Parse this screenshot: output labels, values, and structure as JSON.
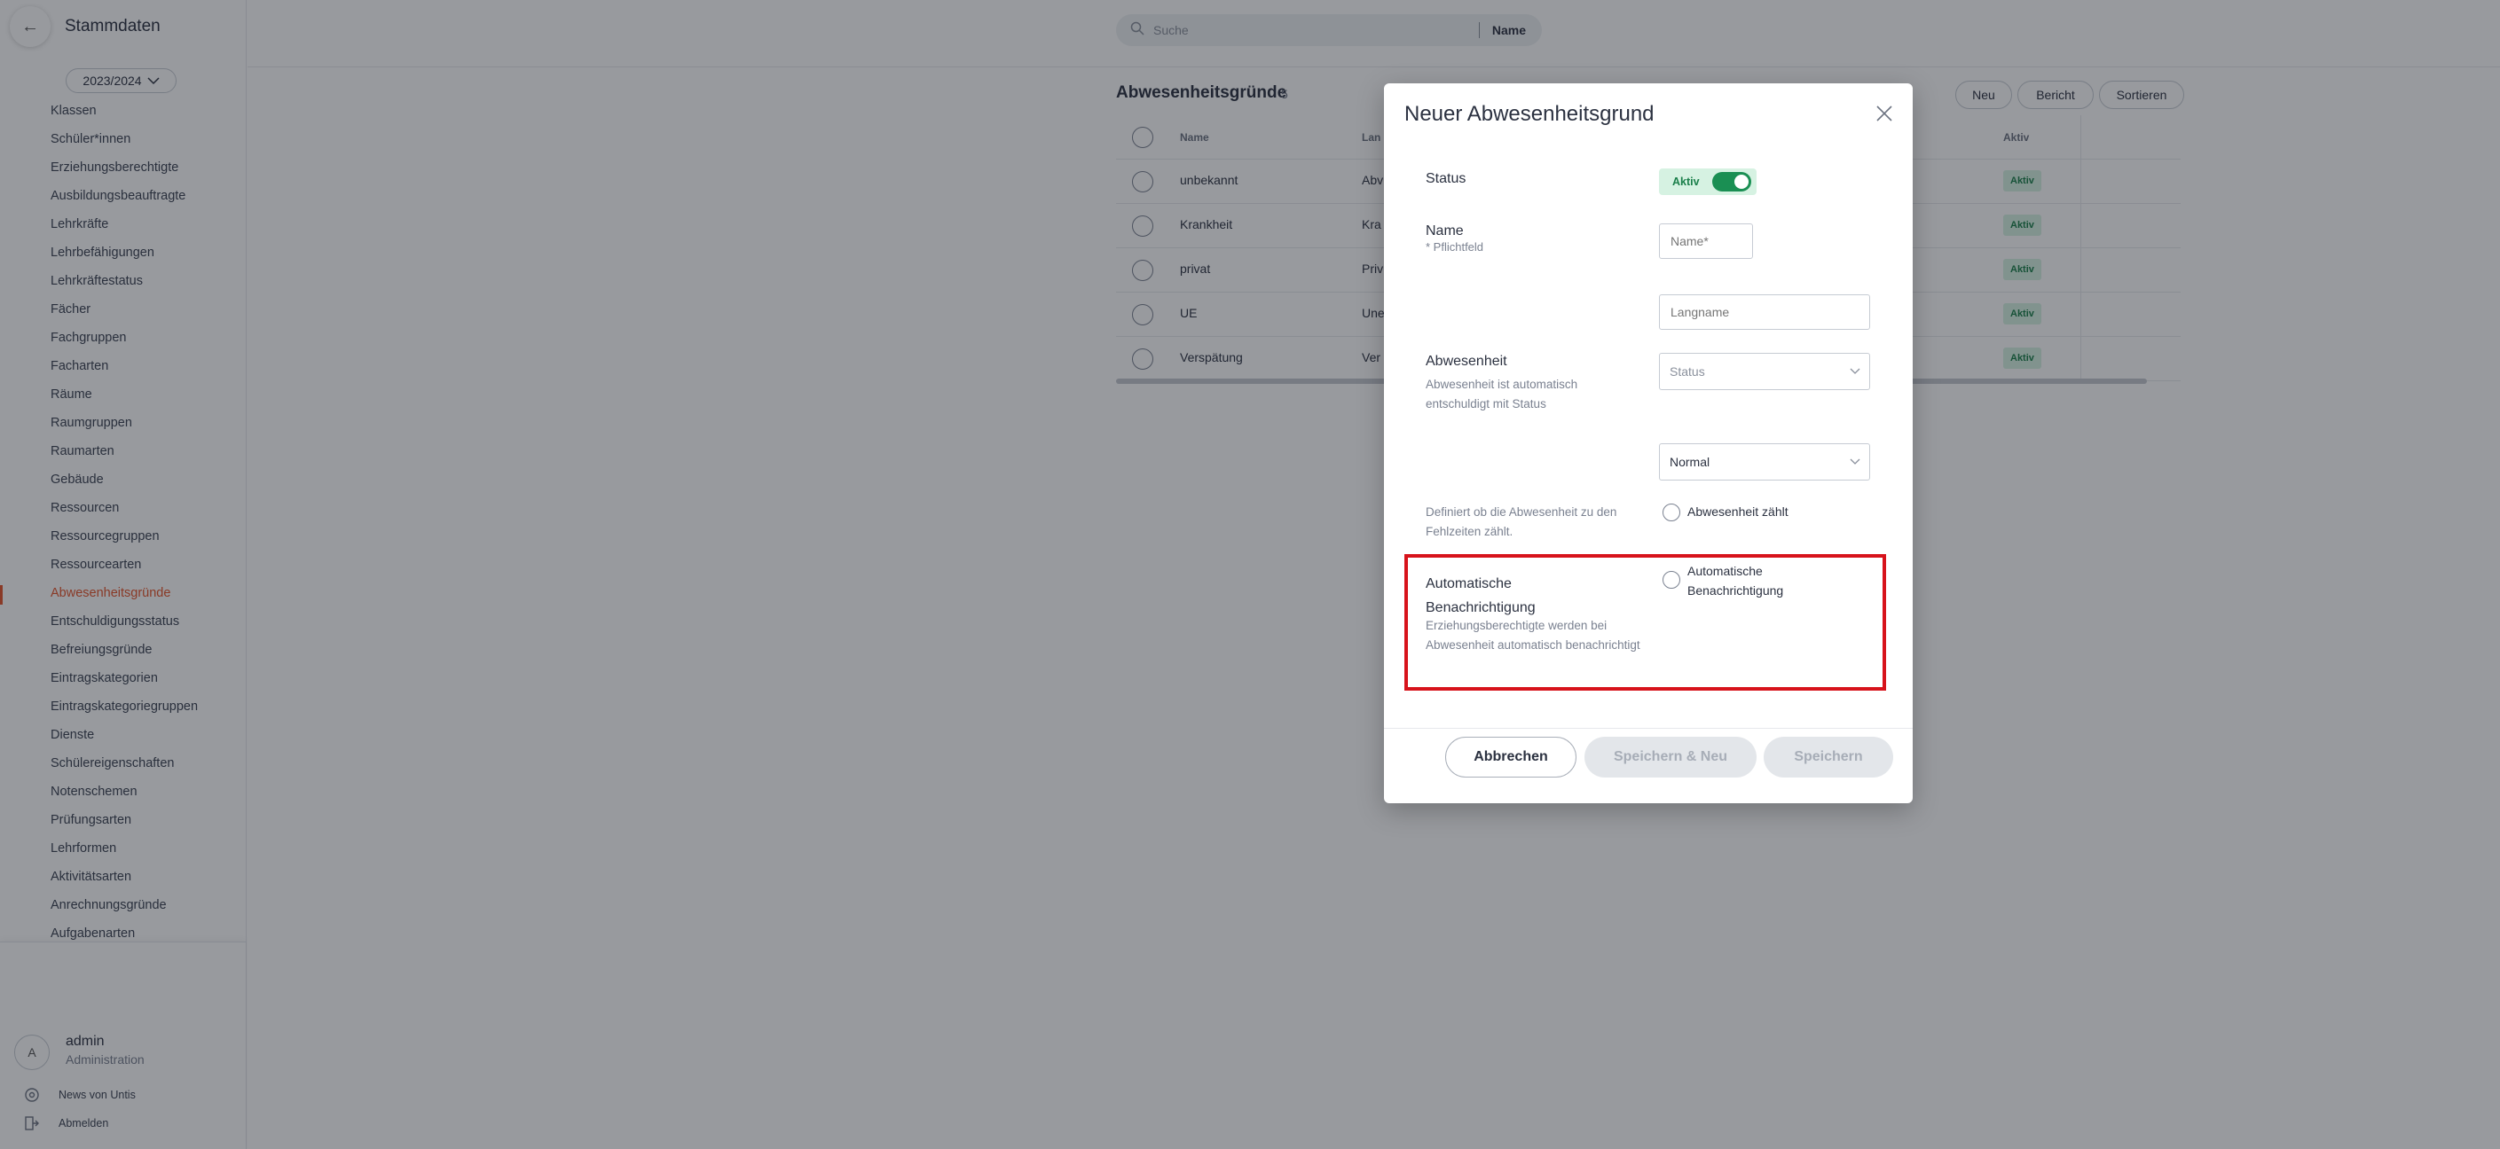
{
  "app": {
    "title": "Stammdaten",
    "back_icon": "arrow-left-icon",
    "school_year": "2023/2024"
  },
  "sidebar": {
    "items": [
      {
        "label": "Klassen",
        "active": false
      },
      {
        "label": "Schüler*innen",
        "active": false
      },
      {
        "label": "Erziehungsberechtigte",
        "active": false
      },
      {
        "label": "Ausbildungsbeauftragte",
        "active": false
      },
      {
        "label": "Lehrkräfte",
        "active": false
      },
      {
        "label": "Lehrbefähigungen",
        "active": false
      },
      {
        "label": "Lehrkräftestatus",
        "active": false
      },
      {
        "label": "Fächer",
        "active": false
      },
      {
        "label": "Fachgruppen",
        "active": false
      },
      {
        "label": "Facharten",
        "active": false
      },
      {
        "label": "Räume",
        "active": false
      },
      {
        "label": "Raumgruppen",
        "active": false
      },
      {
        "label": "Raumarten",
        "active": false
      },
      {
        "label": "Gebäude",
        "active": false
      },
      {
        "label": "Ressourcen",
        "active": false
      },
      {
        "label": "Ressourcegruppen",
        "active": false
      },
      {
        "label": "Ressourcearten",
        "active": false
      },
      {
        "label": "Abwesenheitsgründe",
        "active": true
      },
      {
        "label": "Entschuldigungsstatus",
        "active": false
      },
      {
        "label": "Befreiungsgründe",
        "active": false
      },
      {
        "label": "Eintragskategorien",
        "active": false
      },
      {
        "label": "Eintragskategoriegruppen",
        "active": false
      },
      {
        "label": "Dienste",
        "active": false
      },
      {
        "label": "Schülereigenschaften",
        "active": false
      },
      {
        "label": "Notenschemen",
        "active": false
      },
      {
        "label": "Prüfungsarten",
        "active": false
      },
      {
        "label": "Lehrformen",
        "active": false
      },
      {
        "label": "Aktivitätsarten",
        "active": false
      },
      {
        "label": "Anrechnungsgründe",
        "active": false
      },
      {
        "label": "Aufgabenarten",
        "active": false
      }
    ],
    "active_color": "#e5542b"
  },
  "user": {
    "initial": "A",
    "name": "admin",
    "role": "Administration",
    "news_label": "News von Untis",
    "logout_label": "Abmelden"
  },
  "search": {
    "placeholder": "Suche",
    "scope": "Name"
  },
  "list": {
    "title": "Abwesenheitsgründe",
    "count": "5",
    "buttons": {
      "new": "Neu",
      "report": "Bericht",
      "sort": "Sortieren"
    },
    "columns": {
      "name": "Name",
      "longname": "Lan",
      "active": "Aktiv"
    },
    "rows": [
      {
        "name": "unbekannt",
        "longname": "Abv",
        "status": "Aktiv"
      },
      {
        "name": "Krankheit",
        "longname": "Kra",
        "status": "Aktiv"
      },
      {
        "name": "privat",
        "longname": "Priv",
        "status": "Aktiv"
      },
      {
        "name": "UE",
        "longname": "Une",
        "status": "Aktiv"
      },
      {
        "name": "Verspätung",
        "longname": "Ver",
        "status": "Aktiv"
      }
    ]
  },
  "modal": {
    "title": "Neuer Abwesenheitsgrund",
    "status_label": "Status",
    "status_toggle": "Aktiv",
    "status_on": true,
    "name_label": "Name",
    "name_required": "* Pflichtfeld",
    "name_placeholder": "Name*",
    "longname_placeholder": "Langname",
    "absence_label": "Abwesenheit",
    "absence_hint": "Abwesenheit ist automatisch entschuldigt mit Status",
    "absence_status_placeholder": "Status",
    "absence_type_value": "Normal",
    "counts_hint": "Definiert ob die Abwesenheit zu den Fehlzeiten zählt.",
    "counts_option": "Abwesenheit zählt",
    "notify_label": "Automatische Benachrichtigung",
    "notify_hint": "Erziehungsberechtigte werden bei Abwesenheit automatisch benachrichtigt",
    "notify_option": "Automatische Benachrichtigung",
    "highlight_color": "#d7131b",
    "cancel": "Abbrechen",
    "save_new": "Speichern & Neu",
    "save": "Speichern"
  },
  "colors": {
    "success_bg": "#d6f2e2",
    "success_text": "#1a7f4a",
    "toggle_on": "#1a8f53"
  }
}
